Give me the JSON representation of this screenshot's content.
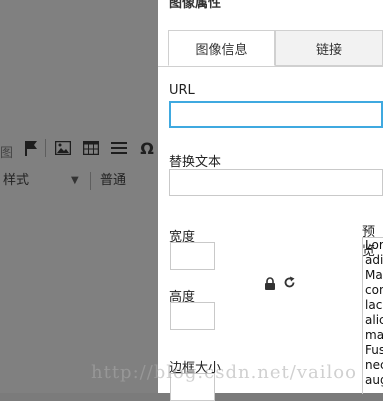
{
  "editor": {
    "cut_text": "图",
    "style_combo": "样式",
    "format_combo": "普通"
  },
  "dialog": {
    "title": "图像属性",
    "tabs": [
      "图像信息",
      "链接"
    ],
    "url_label": "URL",
    "alt_label": "替换文本",
    "width_label": "宽度",
    "height_label": "高度",
    "border_label": "边框大小",
    "preview_label": "预览",
    "preview_lines": [
      "Lor",
      "adi",
      "Mae",
      "con",
      "laci",
      "alic",
      "ma",
      "Fus",
      "nec",
      "aug"
    ]
  },
  "watermark": "http://blog.csdn.net/vailoo"
}
